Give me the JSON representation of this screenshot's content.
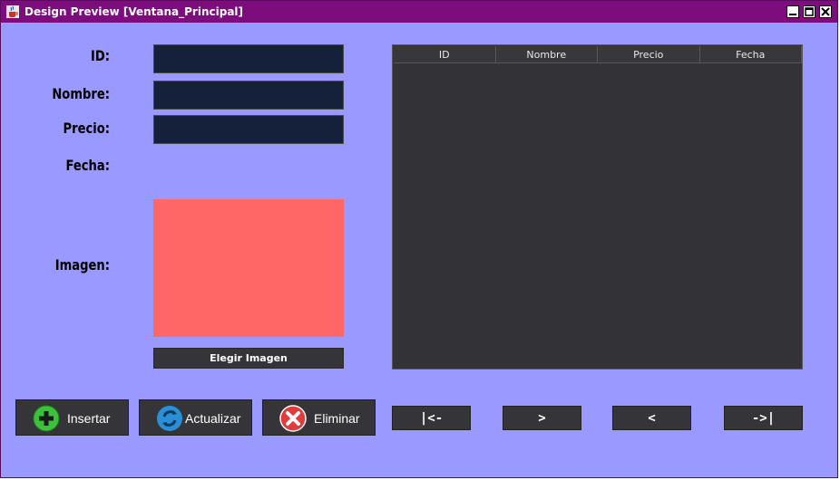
{
  "window": {
    "title": "Design Preview [Ventana_Principal]"
  },
  "form": {
    "id_label": "ID:",
    "nombre_label": "Nombre:",
    "precio_label": "Precio:",
    "fecha_label": "Fecha:",
    "imagen_label": "Imagen:",
    "id_value": "",
    "nombre_value": "",
    "precio_value": "",
    "choose_image_label": "Elegir Imagen"
  },
  "table": {
    "columns": [
      "ID",
      "Nombre",
      "Precio",
      "Fecha"
    ],
    "rows": []
  },
  "actions": {
    "insert_label": "Insertar",
    "update_label": "Actualizar",
    "delete_label": "Eliminar"
  },
  "navigation": {
    "first_label": "|<-",
    "next_label": ">",
    "prev_label": "<",
    "last_label": "->|"
  },
  "colors": {
    "background": "#9999ff",
    "titlebar": "#7d0d7d",
    "field": "#15203a",
    "table": "#333236",
    "image_placeholder": "#ff6666",
    "button": "#353438"
  }
}
